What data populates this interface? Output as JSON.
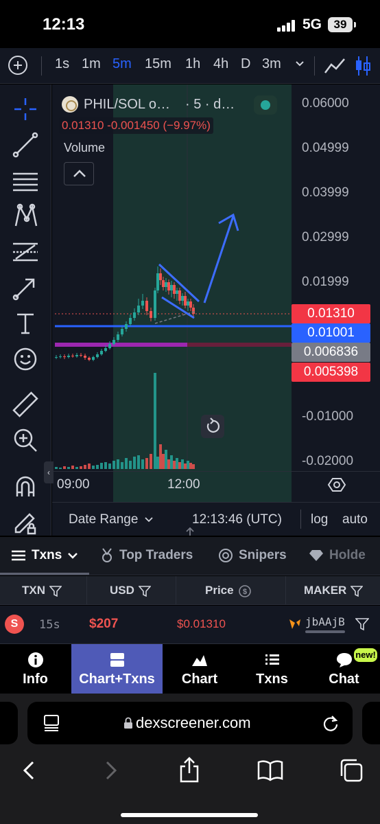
{
  "status_bar": {
    "time": "12:13",
    "network": "5G",
    "battery": "39"
  },
  "timeframes": [
    "1s",
    "1m",
    "5m",
    "15m",
    "1h",
    "4h",
    "D",
    "3m"
  ],
  "active_timeframe": "5m",
  "chart": {
    "pair": "PHIL/SOL o…",
    "interval": "· 5 · d…",
    "ohlc": "0.01310  -0.001450 (−9.97%)",
    "volume_label": "Volume",
    "price_ticks": [
      "0.06000",
      "0.04999",
      "0.03999",
      "0.02999",
      "0.01999",
      "-0.01000",
      "-0.02000"
    ],
    "price_tags": [
      {
        "label": "0.01310",
        "color": "#f23645"
      },
      {
        "label": "0.01001",
        "color": "#2962ff"
      },
      {
        "label": "0.006836",
        "color": "#787b86"
      },
      {
        "label": "0.005398",
        "color": "#f23645"
      }
    ],
    "time_ticks": [
      "09:00",
      "12:00"
    ],
    "colors": {
      "up": "#26a69a",
      "down": "#ef5350",
      "drawing": "#3d6dff",
      "band": "#9c27b0"
    }
  },
  "chart_footer": {
    "date_range": "Date Range",
    "clock": "12:13:46 (UTC)",
    "log": "log",
    "auto": "auto"
  },
  "tabs": [
    {
      "label": "Txns",
      "icon": "menu-icon"
    },
    {
      "label": "Top Traders",
      "icon": "medal-icon"
    },
    {
      "label": "Snipers",
      "icon": "target-icon"
    },
    {
      "label": "Holde",
      "icon": "diamond-icon"
    }
  ],
  "table": {
    "headers": [
      "TXN",
      "USD",
      "Price",
      "MAKER"
    ],
    "rows": [
      {
        "type": "S",
        "age": "15s",
        "usd": "$207",
        "price": "$0.01310",
        "maker": "jbAAjB"
      }
    ]
  },
  "bottom_nav": [
    {
      "label": "Info",
      "icon": "info-icon"
    },
    {
      "label": "Chart+Txns",
      "icon": "split-icon"
    },
    {
      "label": "Chart",
      "icon": "mountain-chart-icon"
    },
    {
      "label": "Txns",
      "icon": "list-icon"
    },
    {
      "label": "Chat",
      "icon": "chat-icon"
    }
  ],
  "new_badge": "new!",
  "browser": {
    "url": "dexscreener.com"
  }
}
